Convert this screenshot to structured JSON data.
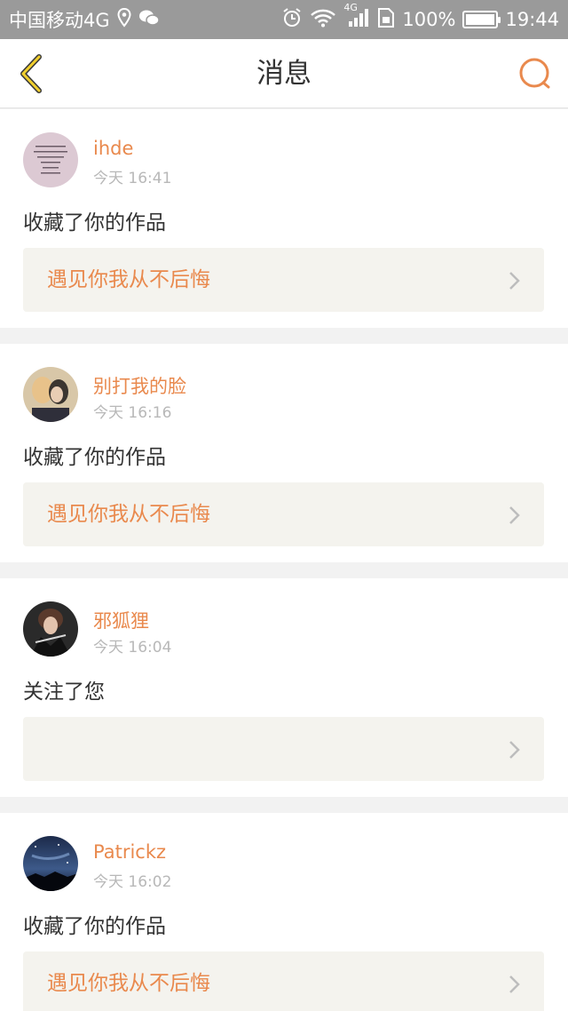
{
  "status_bar": {
    "carrier": "中国移动4G",
    "network_small": "4G",
    "battery": "100%",
    "battery_level": 1.0,
    "time": "19:44",
    "icons": [
      "location-icon",
      "wechat-icon",
      "alarm-icon",
      "wifi-icon",
      "signal-icon",
      "sim-icon",
      "battery-icon"
    ]
  },
  "header": {
    "title": "消息",
    "back_icon": "back-chevron-icon",
    "search_icon": "search-icon",
    "accent_color": "#e9894d"
  },
  "messages": [
    {
      "name": "ihde",
      "time": "今天 16:41",
      "action": "收藏了你的作品",
      "work_title": "遇见你我从不后悔"
    },
    {
      "name": "别打我的脸",
      "time": "今天 16:16",
      "action": "收藏了你的作品",
      "work_title": "遇见你我从不后悔"
    },
    {
      "name": "邪狐狸",
      "time": "今天 16:04",
      "action": "关注了您",
      "work_title": ""
    },
    {
      "name": "Patrickz",
      "time": "今天 16:02",
      "action": "收藏了你的作品",
      "work_title": "遇见你我从不后悔"
    }
  ]
}
